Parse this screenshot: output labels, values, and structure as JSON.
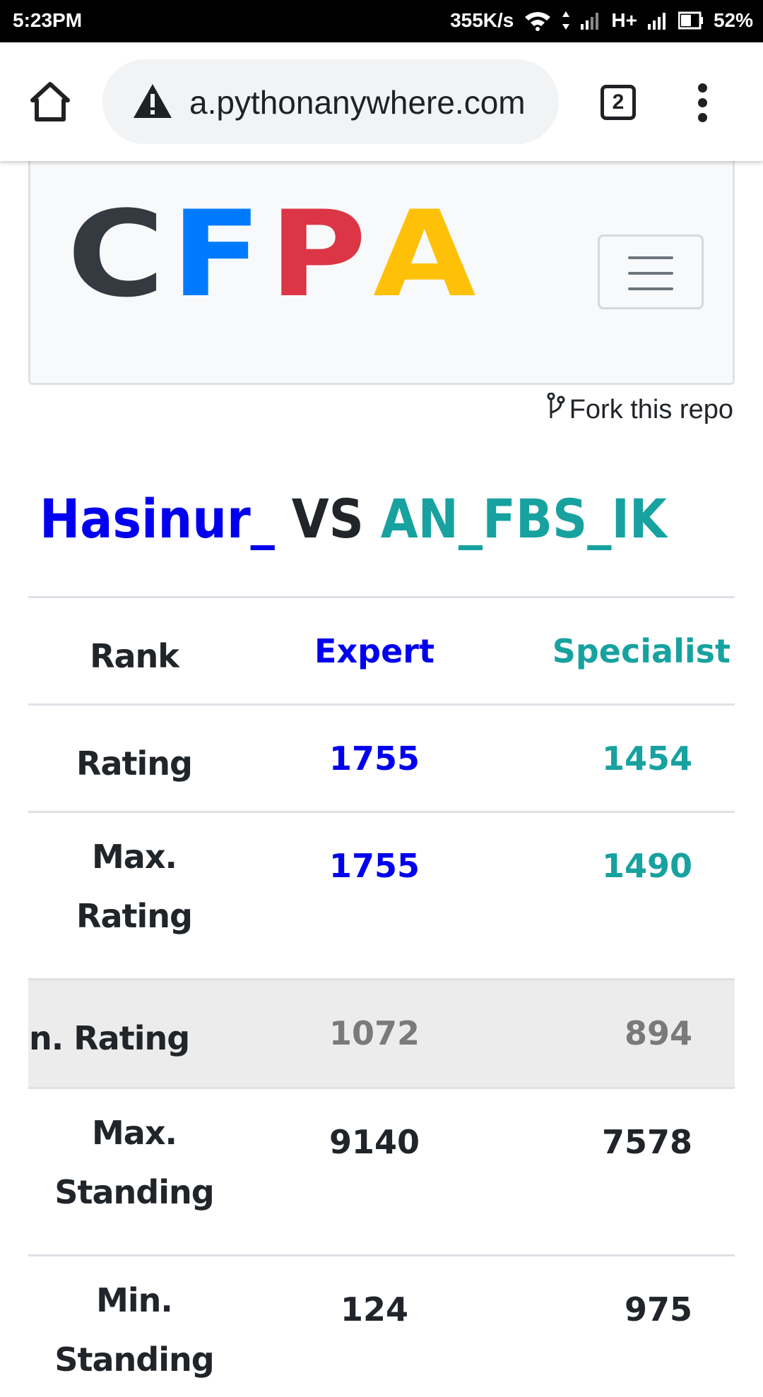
{
  "status_bar": {
    "time": "5:23PM",
    "net_speed": "355K/s",
    "network_type": "H+",
    "battery": "52%",
    "icons": [
      "wifi-icon",
      "data-arrows-icon",
      "signal-icon",
      "signal-icon",
      "battery-icon"
    ]
  },
  "browser": {
    "url": "a.pythonanywhere.com",
    "tab_count": "2",
    "icons": {
      "home": "home-icon",
      "security": "warning-triangle-icon",
      "menu": "kebab-menu-icon"
    }
  },
  "navbar": {
    "logo": {
      "letters": [
        "C",
        "F",
        "P",
        "A"
      ],
      "colors": [
        "#343a40",
        "#007bff",
        "#dc3545",
        "#ffc107"
      ]
    },
    "toggler_icon": "hamburger-icon"
  },
  "fork_link": {
    "label": "Fork this repo",
    "icon": "git-branch-icon"
  },
  "comparison": {
    "user1": "Hasinur_",
    "vs": "VS",
    "user2": "AN_FBS_IK",
    "colors": {
      "user1": "#0000ee",
      "user2": "#17a2a0"
    },
    "rows": [
      {
        "label_lines": [
          "Rank"
        ],
        "v1": "Expert",
        "v2": "Specialist"
      },
      {
        "label_lines": [
          "Rating"
        ],
        "v1": "1755",
        "v2": "1454"
      },
      {
        "label_lines": [
          "Max.",
          "Rating"
        ],
        "v1": "1755",
        "v2": "1490"
      },
      {
        "label_lines": [
          "n. Rating"
        ],
        "v1": "1072",
        "v2": "894"
      },
      {
        "label_lines": [
          "Max.",
          "Standing"
        ],
        "v1": "9140",
        "v2": "7578"
      },
      {
        "label_lines": [
          "Min.",
          "Standing"
        ],
        "v1": "124",
        "v2": "975"
      }
    ]
  }
}
